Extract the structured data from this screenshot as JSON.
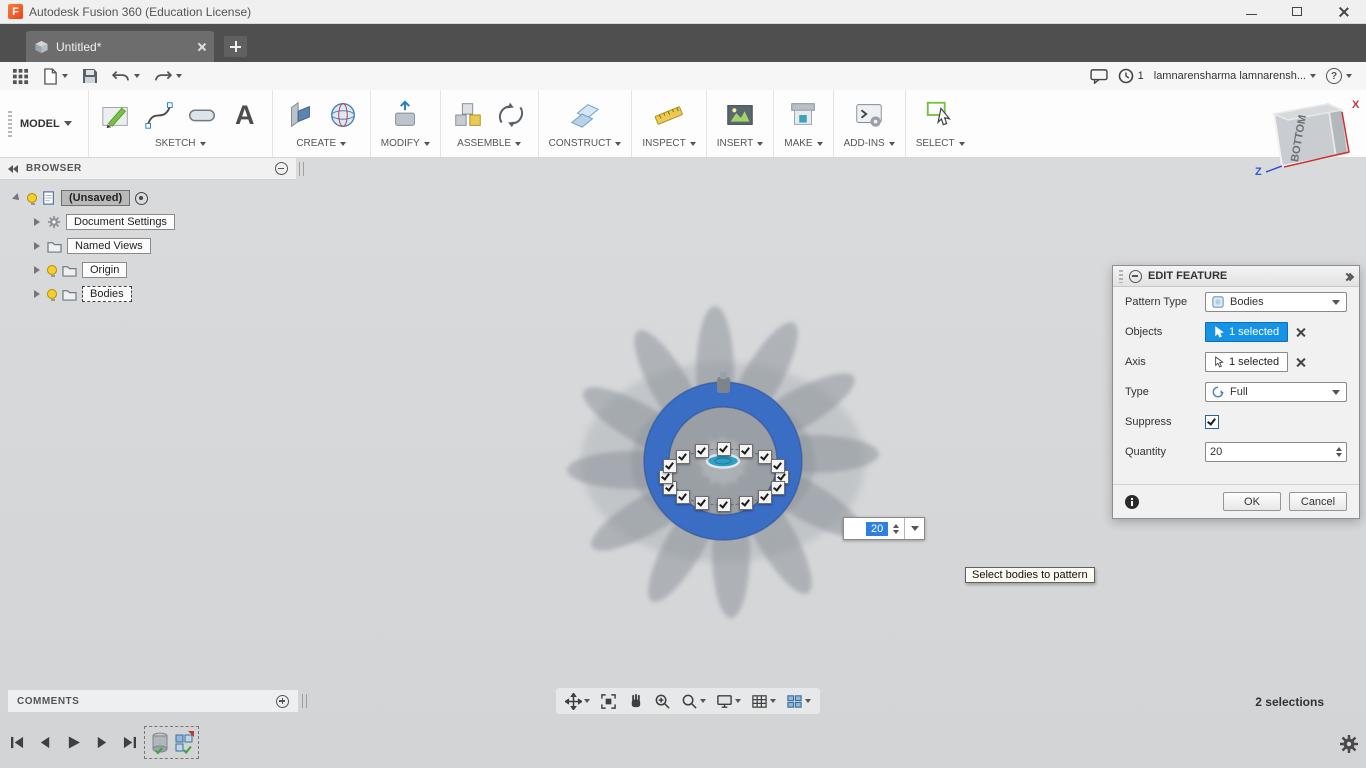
{
  "window": {
    "title": "Autodesk Fusion 360 (Education License)"
  },
  "tabbar": {
    "active_tab": "Untitled*"
  },
  "qat": {
    "notification_count": "1",
    "user_name": "lamnarensharma lamnarensh...",
    "help": "?"
  },
  "ribbon": {
    "workspace": "MODEL",
    "groups": [
      "SKETCH",
      "CREATE",
      "MODIFY",
      "ASSEMBLE",
      "CONSTRUCT",
      "INSPECT",
      "INSERT",
      "MAKE",
      "ADD-INS",
      "SELECT"
    ],
    "text_tool": "A"
  },
  "browser": {
    "title": "BROWSER",
    "root_label": "(Unsaved)",
    "items": [
      "Document Settings",
      "Named Views",
      "Origin",
      "Bodies"
    ]
  },
  "viewcube": {
    "face": "BOTTOM",
    "axis_x": "X",
    "axis_z": "Z"
  },
  "dialog": {
    "title": "EDIT FEATURE",
    "pattern_type_label": "Pattern Type",
    "pattern_type_value": "Bodies",
    "objects_label": "Objects",
    "objects_value": "1 selected",
    "axis_label": "Axis",
    "axis_value": "1 selected",
    "type_label": "Type",
    "type_value": "Full",
    "suppress_label": "Suppress",
    "quantity_label": "Quantity",
    "quantity_value": "20",
    "ok": "OK",
    "cancel": "Cancel"
  },
  "canvas": {
    "floating_quantity": "20",
    "tooltip": "Select bodies to pattern"
  },
  "statusbar": {
    "selections": "2 selections",
    "comments_title": "COMMENTS"
  },
  "colors": {
    "accent_blue": "#1593e6",
    "ring_blue": "#3a6dc4",
    "hub_teal": "#2f9fc4"
  }
}
